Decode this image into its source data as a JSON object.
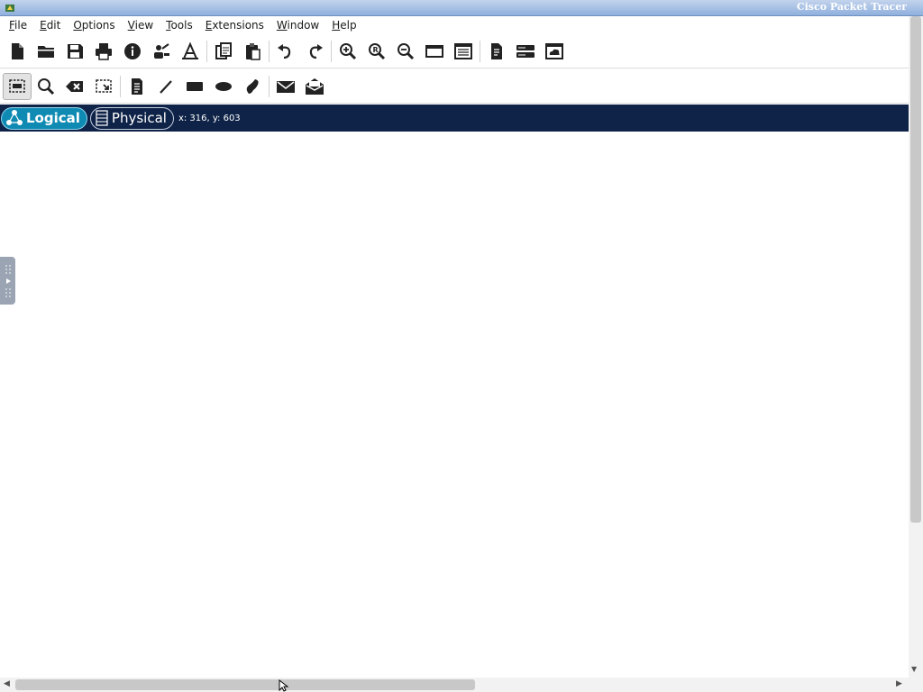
{
  "window": {
    "title": "Cisco Packet Tracer"
  },
  "menubar": {
    "items": [
      "File",
      "Edit",
      "Options",
      "View",
      "Tools",
      "Extensions",
      "Window",
      "Help"
    ]
  },
  "toolbar_main": {
    "icons": [
      "new-file-icon",
      "open-folder-icon",
      "save-icon",
      "print-icon",
      "info-icon",
      "network-activity-wizard-icon",
      "custom-device-icon",
      "copy-icon",
      "paste-icon",
      "undo-icon",
      "redo-icon",
      "zoom-in-icon",
      "zoom-reset-icon",
      "zoom-out-icon",
      "drawing-palette-icon",
      "custom-devices-dialog-icon",
      "viewport-icon",
      "device-panel-icon",
      "cloud-icon"
    ]
  },
  "toolbar_draw": {
    "icons": [
      "select-icon",
      "inspect-icon",
      "delete-icon",
      "resize-shape-icon",
      "place-note-icon",
      "draw-line-icon",
      "draw-rectangle-icon",
      "draw-ellipse-icon",
      "freeform-icon",
      "add-simple-pdu-icon",
      "add-complex-pdu-icon"
    ],
    "selected": "select-icon"
  },
  "modebar": {
    "logical_label": "Logical",
    "physical_label": "Physical",
    "coords": "x: 316, y: 603",
    "colors": {
      "bar": "#0e2347",
      "logical_active": "#0f8ab2"
    }
  }
}
